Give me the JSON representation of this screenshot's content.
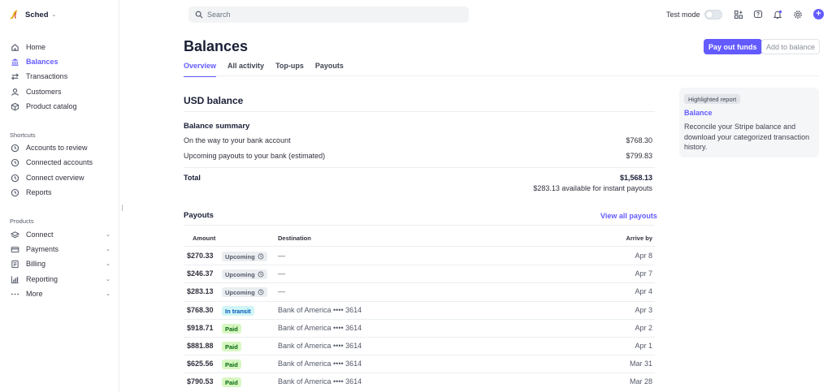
{
  "brand": {
    "name": "Sched"
  },
  "sidebar": {
    "main": [
      {
        "label": "Home",
        "icon": "home-icon"
      },
      {
        "label": "Balances",
        "icon": "balance-icon",
        "active": true
      },
      {
        "label": "Transactions",
        "icon": "arrows-icon"
      },
      {
        "label": "Customers",
        "icon": "person-icon"
      },
      {
        "label": "Product catalog",
        "icon": "box-icon"
      }
    ],
    "shortcuts_label": "Shortcuts",
    "shortcuts": [
      {
        "label": "Accounts to review",
        "icon": "clock-icon"
      },
      {
        "label": "Connected accounts",
        "icon": "clock-icon"
      },
      {
        "label": "Connect overview",
        "icon": "clock-icon"
      },
      {
        "label": "Reports",
        "icon": "clock-icon"
      }
    ],
    "products_label": "Products",
    "products": [
      {
        "label": "Connect",
        "icon": "layers-icon"
      },
      {
        "label": "Payments",
        "icon": "card-icon"
      },
      {
        "label": "Billing",
        "icon": "billing-icon"
      },
      {
        "label": "Reporting",
        "icon": "chart-icon"
      },
      {
        "label": "More",
        "icon": "dots-icon"
      }
    ]
  },
  "topbar": {
    "search_placeholder": "Search",
    "test_mode_label": "Test mode",
    "accent": "#635bff"
  },
  "page": {
    "title": "Balances",
    "pay_out_button": "Pay out funds",
    "add_balance_button": "Add to balance",
    "tabs": [
      "Overview",
      "All activity",
      "Top-ups",
      "Payouts"
    ]
  },
  "balance": {
    "heading": "USD balance",
    "summary_heading": "Balance summary",
    "rows": [
      {
        "label": "On the way to your bank account",
        "value": "$768.30"
      },
      {
        "label": "Upcoming payouts to your bank (estimated)",
        "value": "$799.83"
      }
    ],
    "total_label": "Total",
    "total_value": "$1,568.13",
    "instant_note": "$283.13 available for instant payouts"
  },
  "payouts": {
    "heading": "Payouts",
    "view_all": "View all payouts",
    "columns": {
      "amount": "Amount",
      "destination": "Destination",
      "arrive": "Arrive by"
    },
    "rows": [
      {
        "amount": "$270.33",
        "status": "Upcoming",
        "kind": "upcoming",
        "destination": "—",
        "date": "Apr 8"
      },
      {
        "amount": "$246.37",
        "status": "Upcoming",
        "kind": "upcoming",
        "destination": "—",
        "date": "Apr 7"
      },
      {
        "amount": "$283.13",
        "status": "Upcoming",
        "kind": "upcoming",
        "destination": "—",
        "date": "Apr 4"
      },
      {
        "amount": "$768.30",
        "status": "In transit",
        "kind": "transit",
        "destination": "Bank of America  •••• 3614",
        "date": "Apr 3"
      },
      {
        "amount": "$918.71",
        "status": "Paid",
        "kind": "paid",
        "destination": "Bank of America  •••• 3614",
        "date": "Apr 2"
      },
      {
        "amount": "$881.88",
        "status": "Paid",
        "kind": "paid",
        "destination": "Bank of America  •••• 3614",
        "date": "Apr 1"
      },
      {
        "amount": "$625.56",
        "status": "Paid",
        "kind": "paid",
        "destination": "Bank of America  •••• 3614",
        "date": "Mar 31"
      },
      {
        "amount": "$790.53",
        "status": "Paid",
        "kind": "paid",
        "destination": "Bank of America  •••• 3614",
        "date": "Mar 28"
      }
    ]
  },
  "report_card": {
    "chip": "Highlighted report",
    "title": "Balance",
    "description": "Reconcile your Stripe balance and download your categorized transaction history."
  }
}
